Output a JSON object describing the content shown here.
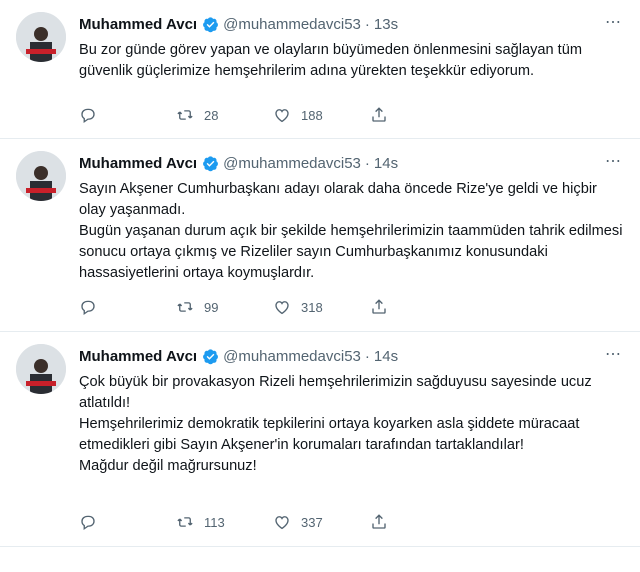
{
  "tweets": [
    {
      "name": "Muhammed Avcı",
      "handle": "@muhammedavci53",
      "separator": "·",
      "time": "13s",
      "text": "Bu zor günde görev yapan ve olayların büyümeden önlenmesini sağlayan tüm güvenlik güçlerimize hemşehrilerim adına yürekten teşekkür ediyorum.",
      "retweets": "28",
      "likes": "188"
    },
    {
      "name": "Muhammed Avcı",
      "handle": "@muhammedavci53",
      "separator": "·",
      "time": "14s",
      "text": "Sayın Akşener Cumhurbaşkanı adayı olarak daha öncede Rize'ye geldi ve hiçbir olay yaşanmadı.\nBugün yaşanan durum açık bir şekilde hemşehrilerimizin taammüden tahrik edilmesi sonucu ortaya çıkmış ve Rizeliler sayın Cumhurbaşkanımız konusundaki hassasiyetlerini ortaya koymuşlardır.",
      "retweets": "99",
      "likes": "318"
    },
    {
      "name": "Muhammed Avcı",
      "handle": "@muhammedavci53",
      "separator": "·",
      "time": "14s",
      "text": "Çok büyük bir provakasyon Rizeli hemşehrilerimizin sağduyusu sayesinde ucuz atlatıldı!\nHemşehrilerimiz demokratik tepkilerini ortaya koyarken asla şiddete müracaat etmedikleri gibi Sayın Akşener'in korumaları tarafından tartaklandılar!\nMağdur değil mağrursunuz!",
      "retweets": "113",
      "likes": "337"
    }
  ],
  "colors": {
    "verified": "#1d9bf0",
    "text": "#0f1419",
    "muted": "#536471",
    "divider": "#e6ecf0"
  },
  "icons": [
    "reply-icon",
    "retweet-icon",
    "like-icon",
    "share-icon",
    "verified-icon",
    "more-icon"
  ]
}
